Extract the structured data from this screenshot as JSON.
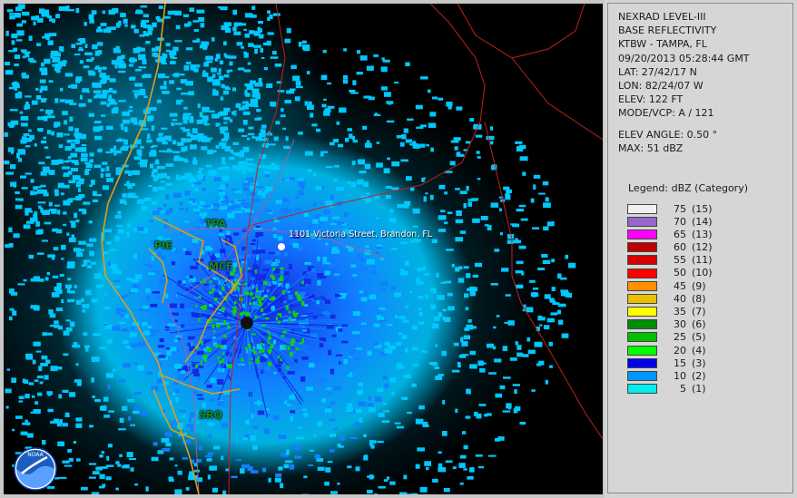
{
  "header": {
    "product": "NEXRAD LEVEL-III",
    "type": "BASE REFLECTIVITY",
    "station": "KTBW - TAMPA, FL",
    "datetime": "09/20/2013 05:28:44 GMT",
    "lat": "LAT: 27/42/17 N",
    "lon": "LON: 82/24/07 W",
    "elev": "ELEV: 122 FT",
    "mode": "MODE/VCP: A / 121",
    "elev_angle": "ELEV ANGLE: 0.50 °",
    "max": "MAX: 51 dBZ"
  },
  "legend": {
    "title": "Legend: dBZ (Category)",
    "items": [
      {
        "dbz": "75",
        "cat": "(15)",
        "color": "#f0f0f0"
      },
      {
        "dbz": "70",
        "cat": "(14)",
        "color": "#9966cc"
      },
      {
        "dbz": "65",
        "cat": "(13)",
        "color": "#ff00ff"
      },
      {
        "dbz": "60",
        "cat": "(12)",
        "color": "#c00000"
      },
      {
        "dbz": "55",
        "cat": "(11)",
        "color": "#d40000"
      },
      {
        "dbz": "50",
        "cat": "(10)",
        "color": "#ff0000"
      },
      {
        "dbz": "45",
        "cat": "(9)",
        "color": "#ff9000"
      },
      {
        "dbz": "40",
        "cat": "(8)",
        "color": "#e8c000"
      },
      {
        "dbz": "35",
        "cat": "(7)",
        "color": "#ffff00"
      },
      {
        "dbz": "30",
        "cat": "(6)",
        "color": "#008c00"
      },
      {
        "dbz": "25",
        "cat": "(5)",
        "color": "#00c000"
      },
      {
        "dbz": "20",
        "cat": "(4)",
        "color": "#00ff00"
      },
      {
        "dbz": "15",
        "cat": "(3)",
        "color": "#0000f0"
      },
      {
        "dbz": "10",
        "cat": "(2)",
        "color": "#0096ff"
      },
      {
        "dbz": "5",
        "cat": "(1)",
        "color": "#00eeee"
      }
    ]
  },
  "map": {
    "places": {
      "tpa": "TPA",
      "pie": "PIE",
      "mcf": "MCF",
      "srq": "SRQ"
    },
    "address": "1101 Victoria Street, Brandon, FL",
    "logo_text": "NOAA",
    "colors": {
      "coast": "#d8a020",
      "county": "#c02020",
      "roads": "#a060a0",
      "light_echo": "#00c8ff",
      "mid_echo": "#1080ff",
      "strong_echo": "#1428e6",
      "green_echo": "#10d010"
    }
  }
}
